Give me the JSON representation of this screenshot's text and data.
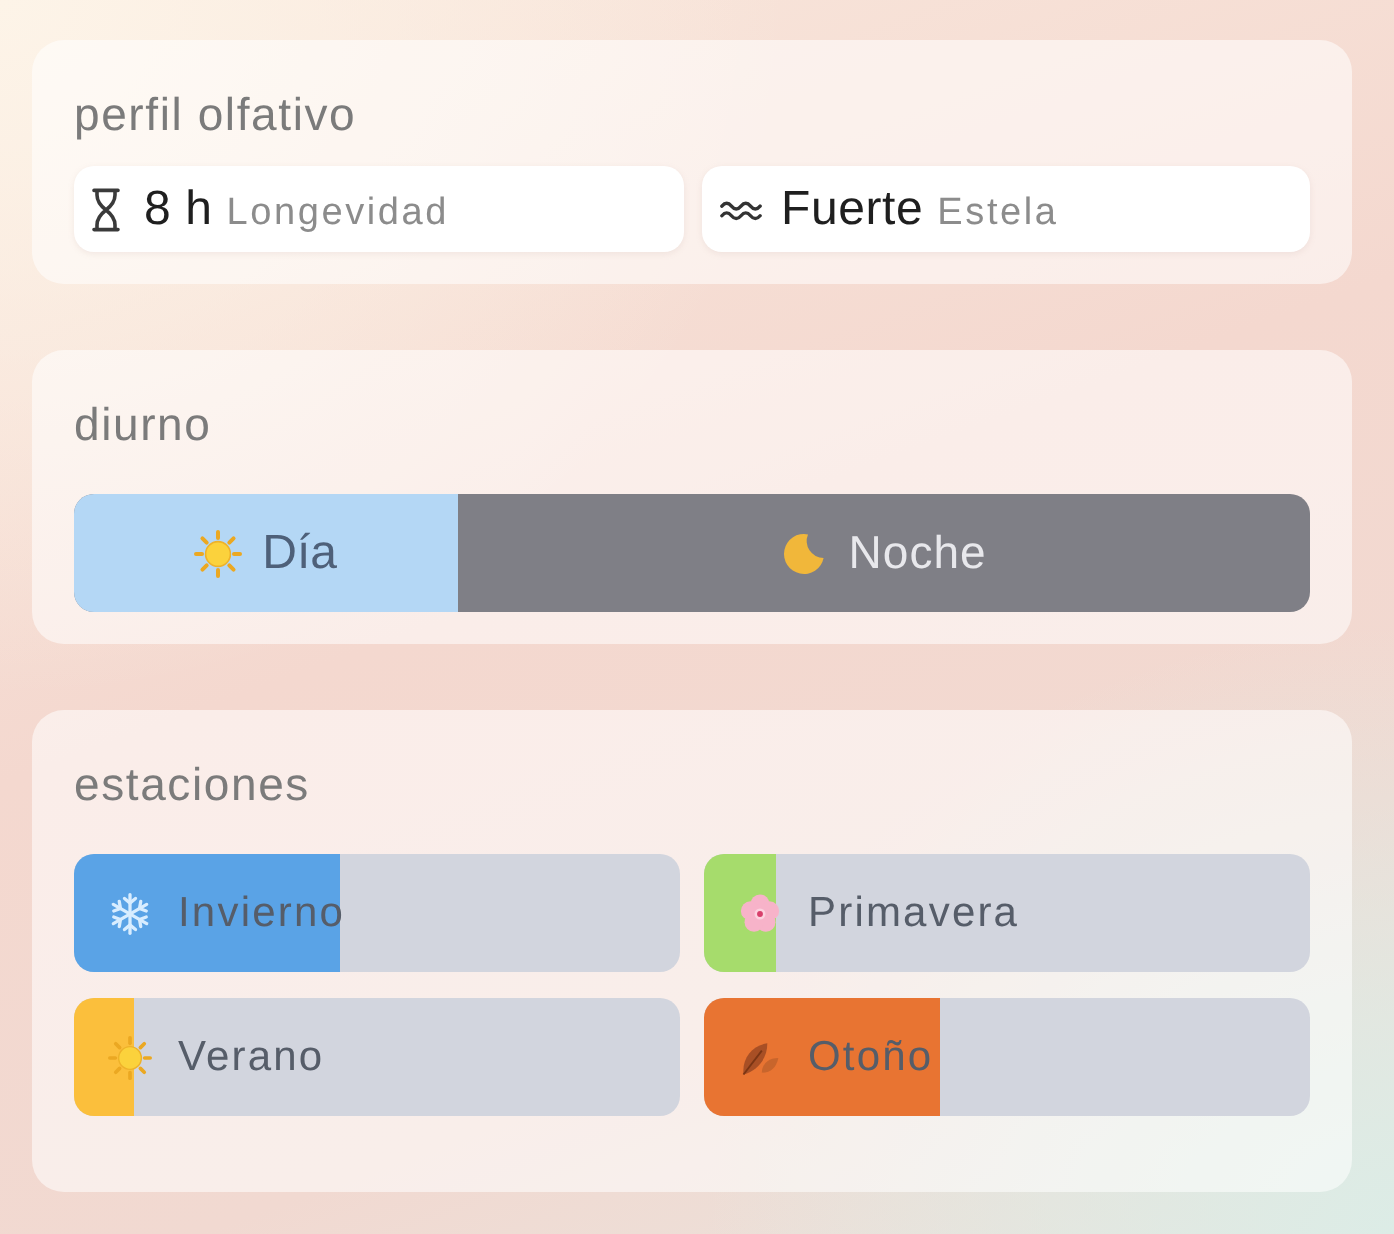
{
  "profile": {
    "title": "perfil olfativo",
    "stats": [
      {
        "kind": "longevity",
        "value": "8 h",
        "label": "Longevidad"
      },
      {
        "kind": "sillage",
        "value": "Fuerte",
        "label": "Estela"
      }
    ]
  },
  "daytime": {
    "title": "diurno",
    "day": {
      "label": "Día",
      "level": 0.31
    },
    "night": {
      "label": "Noche"
    }
  },
  "seasons": {
    "title": "estaciones",
    "items": [
      {
        "kind": "winter",
        "label": "Invierno",
        "level": 0.44,
        "color": "#5aa3e6"
      },
      {
        "kind": "spring",
        "label": "Primavera",
        "level": 0.12,
        "color": "#a6dc6c"
      },
      {
        "kind": "summer",
        "label": "Verano",
        "level": 0.1,
        "color": "#fbbf3c"
      },
      {
        "kind": "autumn",
        "label": "Otoño",
        "level": 0.39,
        "color": "#e87432"
      }
    ]
  }
}
